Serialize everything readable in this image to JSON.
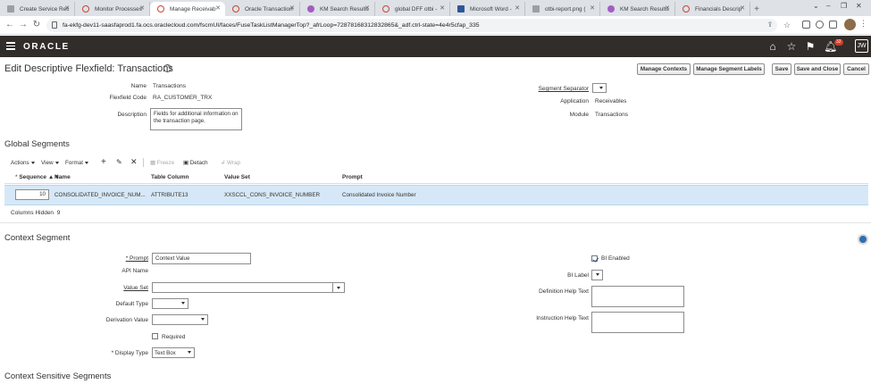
{
  "browser": {
    "tabs": [
      {
        "label": "Create Service Rec",
        "icon": "doc",
        "active": false
      },
      {
        "label": "Monitor Processes",
        "icon": "oracle",
        "active": false
      },
      {
        "label": "Manage Receivab",
        "icon": "oracle",
        "active": true
      },
      {
        "label": "Oracle Transaction",
        "icon": "oracle",
        "active": false
      },
      {
        "label": "KM Search Results",
        "icon": "km",
        "active": false
      },
      {
        "label": "global DFF otbi -",
        "icon": "oracle",
        "active": false
      },
      {
        "label": "Microsoft Word -",
        "icon": "word",
        "active": false
      },
      {
        "label": "otbi-report.png (",
        "icon": "doc",
        "active": false
      },
      {
        "label": "KM Search Results",
        "icon": "km",
        "active": false
      },
      {
        "label": "Financials Descrip",
        "icon": "oracle",
        "active": false
      }
    ],
    "url": "fa-ekfg-dev11-saasfaprod1.fa.ocs.oraclecloud.com/fscmUI/faces/FuseTaskListManagerTop?_afrLoop=72878168312832865&_adf.ctrl-state=4e4r5cfap_335"
  },
  "app": {
    "logo": "ORACLE",
    "notification_count": "32",
    "user_initials": "JW"
  },
  "page": {
    "title": "Edit Descriptive Flexfield: Transactions",
    "buttons": {
      "manage_contexts": "Manage Contexts",
      "manage_segment_labels": "Manage Segment Labels",
      "save": "Save",
      "save_and_close": "Save and Close",
      "cancel": "Cancel"
    },
    "header": {
      "name_label": "Name",
      "name_value": "Transactions",
      "code_label": "Flexfield Code",
      "code_value": "RA_CUSTOMER_TRX",
      "description_label": "Description",
      "description_value": "Fields for additional information on the transaction page.",
      "separator_label": "Segment Separator",
      "application_label": "Application",
      "application_value": "Receivables",
      "module_label": "Module",
      "module_value": "Transactions"
    }
  },
  "global_segments": {
    "title": "Global Segments",
    "toolbar": {
      "actions": "Actions",
      "view": "View",
      "format": "Format",
      "freeze": "Freeze",
      "detach": "Detach",
      "wrap": "Wrap"
    },
    "columns": [
      "Sequence",
      "Name",
      "Table Column",
      "Value Set",
      "Prompt"
    ],
    "rows": [
      {
        "sequence": "10",
        "name": "CONSOLIDATED_INVOICE_NUM...",
        "table_column": "ATTRIBUTE13",
        "value_set": "XXSCCL_CONS_INVOICE_NUMBER",
        "prompt": "Consolidated Invoice Number"
      }
    ],
    "columns_hidden_label": "Columns Hidden",
    "columns_hidden_count": "9"
  },
  "context_segment": {
    "title": "Context Segment",
    "prompt_label": "Prompt",
    "prompt_value": "Context Value",
    "api_name_label": "API Name",
    "value_set_label": "Value Set",
    "default_type_label": "Default Type",
    "derivation_value_label": "Derivation Value",
    "required_label": "Required",
    "display_type_label": "Display Type",
    "display_type_value": "Text Box",
    "bi_enabled_label": "BI Enabled",
    "bi_label_label": "BI Label",
    "definition_help_label": "Definition Help Text",
    "instruction_help_label": "Instruction Help Text"
  },
  "context_sensitive": {
    "title": "Context Sensitive Segments"
  }
}
